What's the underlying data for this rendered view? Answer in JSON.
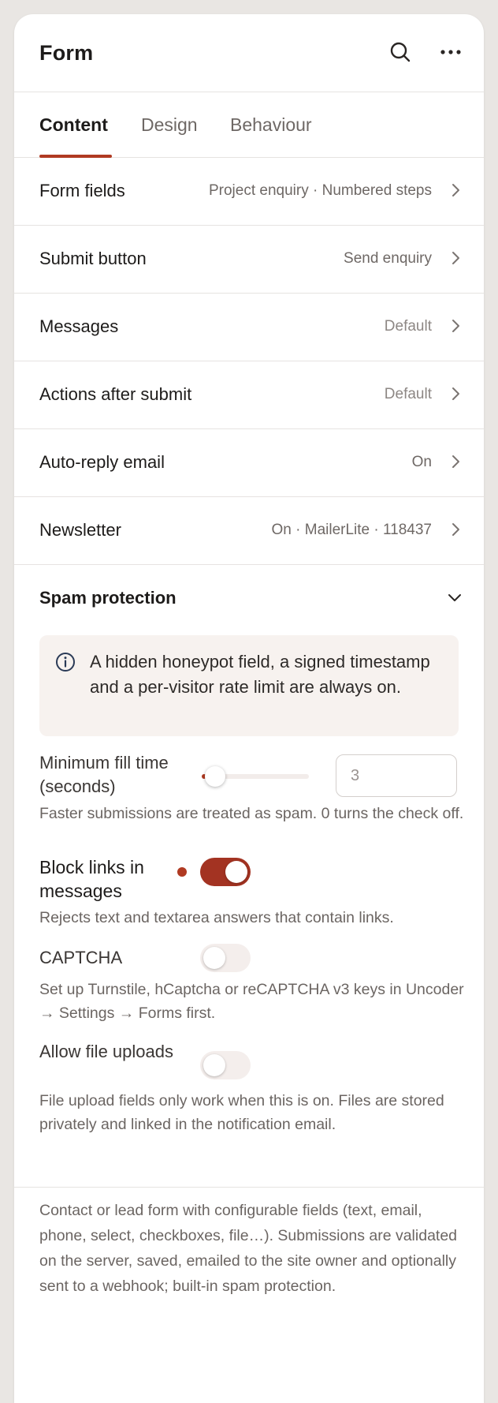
{
  "header": {
    "title": "Form",
    "icons": [
      "search-icon",
      "more-icon"
    ]
  },
  "tabs": [
    {
      "label": "Content",
      "active": true
    },
    {
      "label": "Design",
      "active": false
    },
    {
      "label": "Behaviour",
      "active": false
    }
  ],
  "rows": [
    {
      "label": "Form fields",
      "value": "Project enquiry · Numbered steps"
    },
    {
      "label": "Submit button",
      "value": "Send enquiry"
    },
    {
      "label": "Messages",
      "value": "Default"
    },
    {
      "label": "Actions after submit",
      "value": "Default"
    },
    {
      "label": "Auto-reply email",
      "value": "On"
    },
    {
      "label": "Newsletter",
      "value": "On · MailerLite · 118437"
    }
  ],
  "spam": {
    "title": "Spam protection",
    "info": "A hidden honeypot field, a signed timestamp and a per-visitor rate limit are always on.",
    "min_fill": {
      "label": "Minimum fill time (seconds)",
      "value": "3",
      "slider_fraction": 0.03,
      "help": "Faster submissions are treated as spam. 0 turns the check off."
    },
    "block_links": {
      "label": "Block links in messages",
      "on": true,
      "help": "Rejects text and textarea answers that contain links."
    },
    "captcha": {
      "label": "CAPTCHA",
      "on": false,
      "help": "Set up Turnstile, hCaptcha or reCAPTCHA v3 keys in Uncoder → Settings → Forms first."
    },
    "file_uploads": {
      "label": "Allow file uploads",
      "on": false,
      "help": "File upload fields only work when this is on. Files are stored privately and linked in the notification email."
    }
  },
  "description": "Contact or lead form with configurable fields (text, email, phone, select, checkboxes, file…). Submissions are validated on the server, saved, emailed to the site owner and optionally sent to a webhook; built-in spam protection.",
  "colors": {
    "accent": "#b03a22",
    "toggle_on": "#a33322",
    "info_bg": "#f7f2ef"
  }
}
